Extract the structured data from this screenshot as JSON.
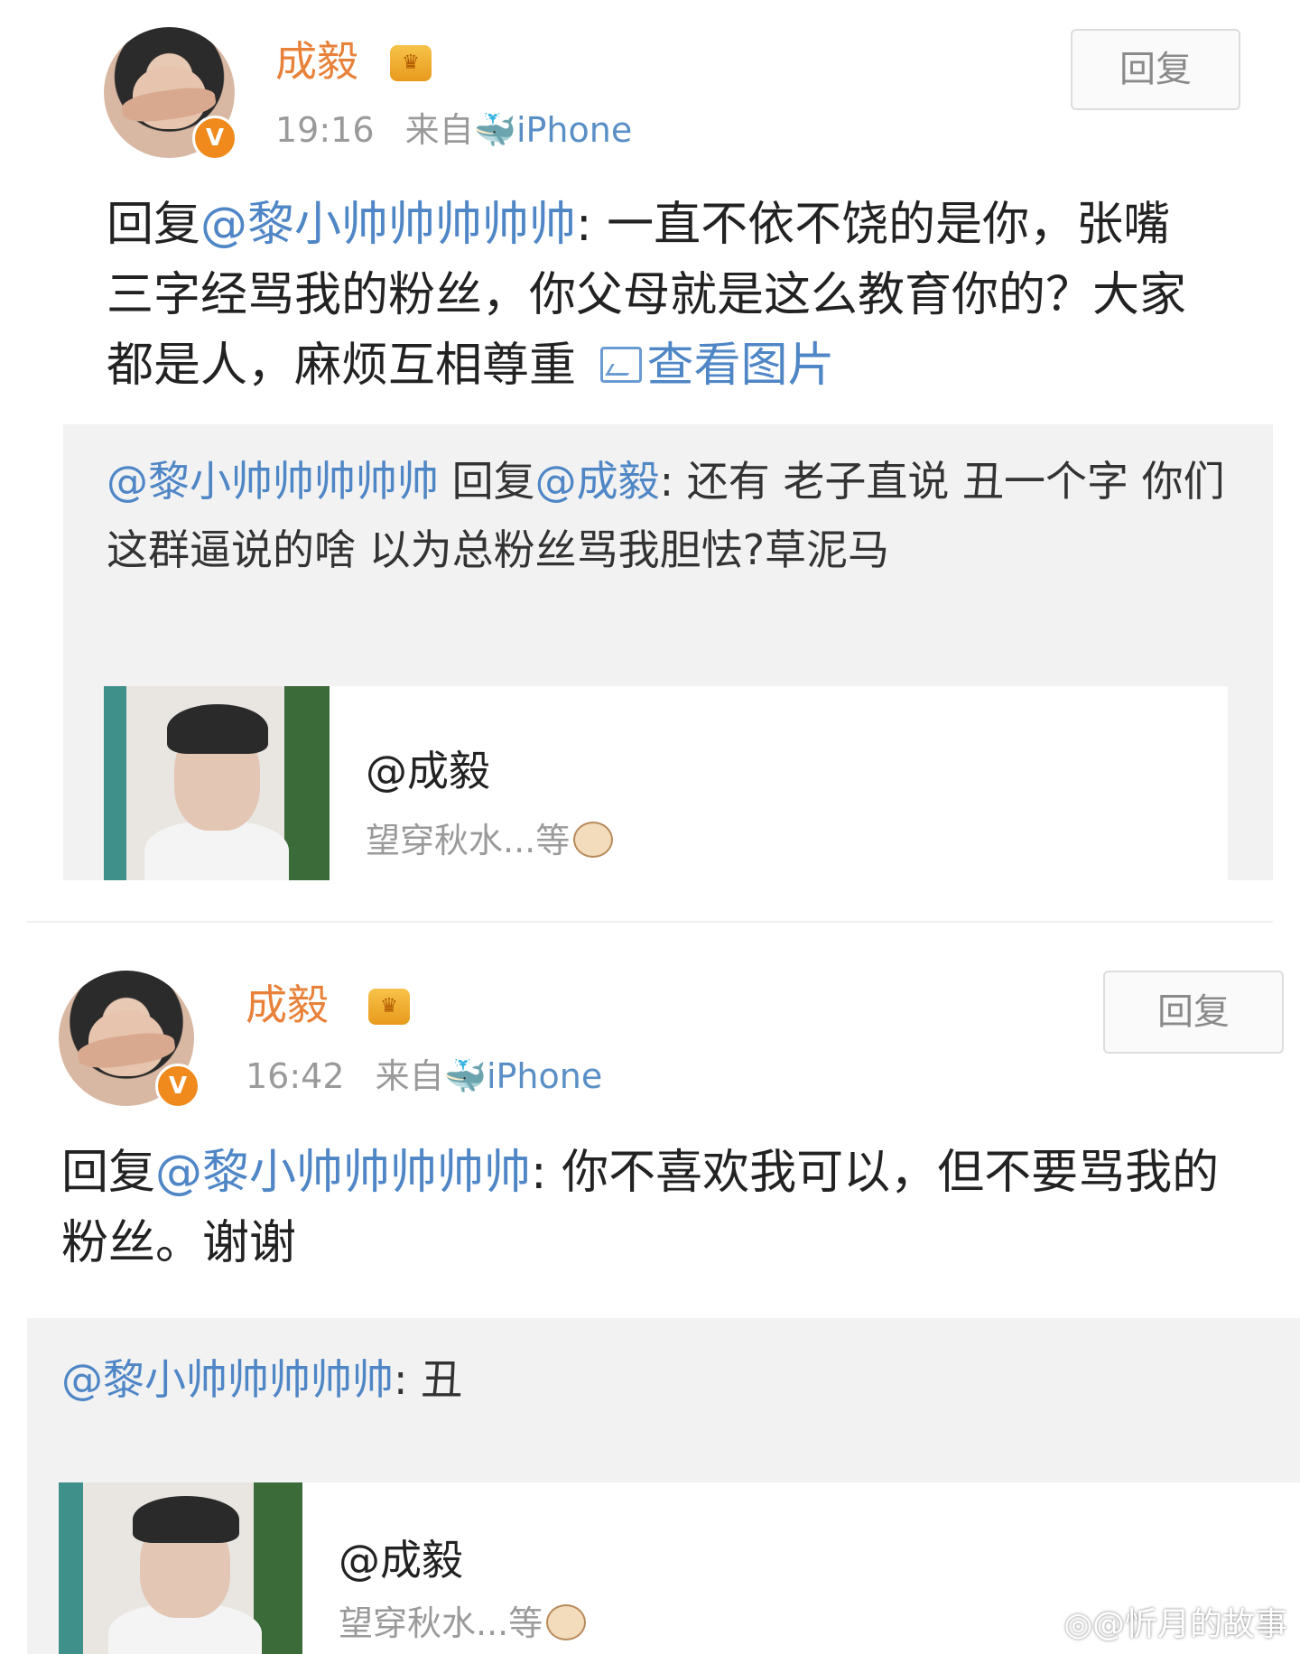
{
  "posts": [
    {
      "author": "成毅",
      "time": "19:16",
      "source_prefix": "来自",
      "source_device": "iPhone",
      "reply_button": "回复",
      "reply_prefix": "回复",
      "reply_mention": "@黎小帅帅帅帅帅",
      "reply_body": ": 一直不依不饶的是你，张嘴三字经骂我的粉丝，你父母就是这么教育你的？大家都是人，麻烦互相尊重",
      "view_image_label": "查看图片",
      "quoted": {
        "mention": "@黎小帅帅帅帅帅",
        "reply_word": " 回复",
        "reply_mention": "@成毅",
        "text": ": 还有 老子直说 丑一个字 你们这群逼说的啥 以为总粉丝骂我胆怯?草泥马"
      },
      "card": {
        "title": "@成毅",
        "subtitle": "望穿秋水...等"
      }
    },
    {
      "author": "成毅",
      "time": "16:42",
      "source_prefix": "来自",
      "source_device": "iPhone",
      "reply_button": "回复",
      "reply_prefix": "回复",
      "reply_mention": "@黎小帅帅帅帅帅",
      "reply_body": ": 你不喜欢我可以，但不要骂我的粉丝。谢谢",
      "quoted": {
        "mention": "@黎小帅帅帅帅帅",
        "text": ": 丑"
      },
      "card": {
        "title": "@成毅",
        "subtitle": "望穿秋水...等"
      }
    }
  ],
  "watermark": "@忻月的故事",
  "colors": {
    "name": "#e8823a",
    "mention": "#4f86c6",
    "meta": "#9a9a9a",
    "quote_bg": "#f2f2f2"
  }
}
